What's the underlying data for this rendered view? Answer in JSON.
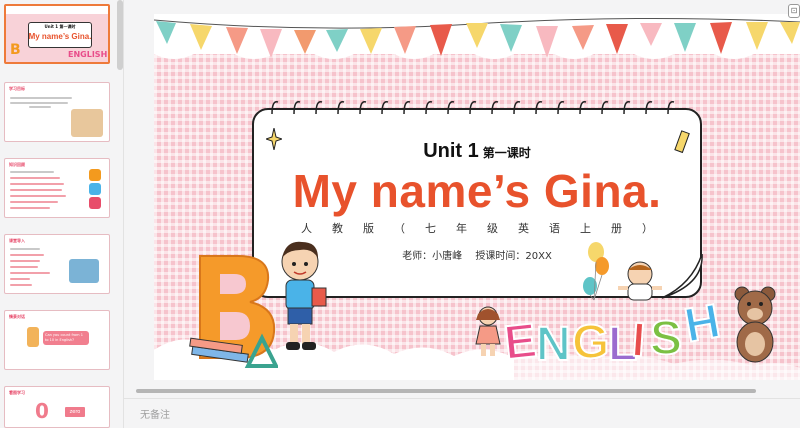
{
  "slide": {
    "unit": "Unit 1",
    "lesson": "第一课时",
    "title": "My name’s Gina.",
    "subtitle": "人教版（七年级英语上册）",
    "teacher": "老师：小唐峰　 授课时间：20XX"
  },
  "thumbnails": [
    {
      "title_line": "Unit 1 第一课时",
      "title": "My name’s Gina."
    },
    {
      "header": "学习目标"
    },
    {
      "header": "知识回顾"
    },
    {
      "header": "课堂导入"
    },
    {
      "header": "情景对话",
      "bubble": "Can you count from 1 to 10 in English?"
    },
    {
      "header": "看图学习",
      "word": "zero",
      "digit": "0"
    }
  ],
  "notes_placeholder": "无备注",
  "colors": {
    "accent": "#ee7a3a",
    "title_red": "#e8522c",
    "pink": "#f6c3cc"
  }
}
